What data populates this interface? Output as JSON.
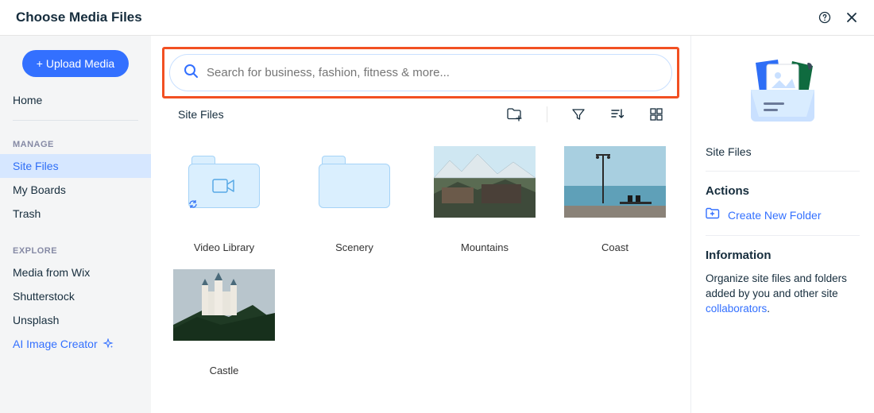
{
  "header": {
    "title": "Choose Media Files"
  },
  "sidebar": {
    "upload_label": "+ Upload Media",
    "home_label": "Home",
    "manage_label": "MANAGE",
    "manage_items": [
      {
        "label": "Site Files",
        "active": true
      },
      {
        "label": "My Boards",
        "active": false
      },
      {
        "label": "Trash",
        "active": false
      }
    ],
    "explore_label": "EXPLORE",
    "explore_items": [
      {
        "label": "Media from Wix"
      },
      {
        "label": "Shutterstock"
      },
      {
        "label": "Unsplash"
      },
      {
        "label": "AI Image Creator",
        "ai": true
      }
    ]
  },
  "search": {
    "placeholder": "Search for business, fashion, fitness & more..."
  },
  "toolbar": {
    "breadcrumb": "Site Files"
  },
  "media": [
    {
      "label": "Video Library",
      "kind": "folder-video"
    },
    {
      "label": "Scenery",
      "kind": "folder"
    },
    {
      "label": "Mountains",
      "kind": "image-mountains"
    },
    {
      "label": "Coast",
      "kind": "image-coast"
    },
    {
      "label": "Castle",
      "kind": "image-castle"
    }
  ],
  "info": {
    "title": "Site Files",
    "actions_label": "Actions",
    "create_folder_label": "Create New Folder",
    "information_label": "Information",
    "info_text_prefix": "Organize site files and folders added by you and other site ",
    "info_text_link": "collaborators",
    "info_text_suffix": "."
  }
}
